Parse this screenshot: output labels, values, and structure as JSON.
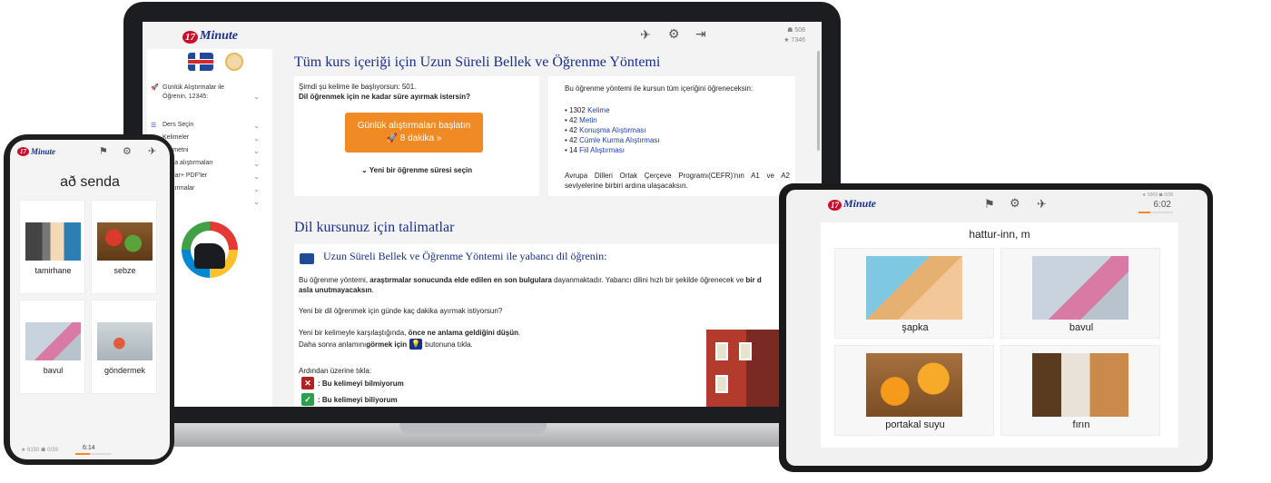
{
  "brand": {
    "logo_num": "17",
    "logo_text": "Minute",
    "logo_sub": "LANGUAGES"
  },
  "laptop": {
    "stats": {
      "line1": "☗ 508",
      "line2": "★ 7346"
    },
    "sidebar": {
      "items": [
        {
          "label": "Günlük Alıştırmalar ile Öğrenin, 12345:",
          "icon": "rocket-icon"
        },
        {
          "label": "Ders Seçin",
          "icon": "list-icon"
        },
        {
          "label": "Kelimeler",
          "icon": ""
        },
        {
          "label": "log metni",
          "icon": ""
        },
        {
          "label": "uşma alıştırmaları",
          "icon": ""
        },
        {
          "label": "rmalar+ PDF'ler",
          "icon": ""
        },
        {
          "label": "Alıştırmalar",
          "icon": ""
        },
        {
          "label": "alar",
          "icon": ""
        }
      ]
    },
    "main": {
      "title": "Tüm kurs içeriği için Uzun Süreli Bellek ve Öğrenme Yöntemi",
      "left_card": {
        "line1": "Şimdi şu kelime ile başlıyorsun: 501.",
        "line2": "Dil öğrenmek için ne kadar süre ayırmak istersin?",
        "button_line1": "Günlük alıştırmaları başlatın",
        "button_line2": "🚀 8 dakika »",
        "new_time": "⌄ Yeni bir öğrenme süresi seçin"
      },
      "right_card": {
        "intro": "Bu öğrenme yöntemi ile kursun tüm içeriğini öğreneceksin:",
        "items": [
          {
            "count": "• 1302",
            "label": "Kelime"
          },
          {
            "count": "• 42",
            "label": "Metin"
          },
          {
            "count": "• 42",
            "label": "Konuşma Alıştırması"
          },
          {
            "count": "• 42",
            "label": "Cümle Kurma Alıştırması"
          },
          {
            "count": "• 14",
            "label": "Fiil Alıştırması"
          }
        ],
        "outro": "Avrupa Dilleri Ortak Çerçeve Programı(CEFR)'nın A1 ve A2 seviyelerine birbiri ardına ulaşacaksın."
      },
      "instructions_title": "Dil kursunuz için talimatlar",
      "method_title": "Uzun Süreli Bellek ve Öğrenme Yöntemi ile yabancı dil öğrenin:",
      "p1_a": "Bu öğrenme yöntemi, ",
      "p1_b": "araştırmalar sonucunda elde edilen en son bulgulara",
      "p1_c": " dayanmaktadır. Yabancı dilini hızlı bir şekilde öğrenecek ve ",
      "p1_d": "bir d",
      "p1_e": "asla unutmayacaksın",
      "p1_f": ".",
      "p2": "Yeni bir dil öğrenmek için günde kaç dakika ayırmak istiyorsun?",
      "p3_a": "Yeni bir kelimeyle karşılaştığında, ",
      "p3_b": "önce ne anlama geldiğini düşün",
      "p3_c": ".",
      "p4_a": "Daha sonra anlamını ",
      "p4_b": "görmek için",
      "p4_c": " butonuna tıkla.",
      "p5": "Ardından üzerine tıkla:",
      "no_label": ": Bu kelimeyi bilmiyorum",
      "yes_label": ": Bu kelimeyi biliyorum"
    }
  },
  "phone": {
    "word": "að senda",
    "tiles": [
      {
        "label": "tamirhane",
        "img": "im-tire"
      },
      {
        "label": "sebze",
        "img": "im-veg"
      },
      {
        "label": "bavul",
        "img": "im-bavul"
      },
      {
        "label": "göndermek",
        "img": "im-gift"
      }
    ],
    "footer_stats": "★ 8150 ☗ 0/39",
    "timer": "6:14"
  },
  "tablet": {
    "stats": "★ 5069 ☗ 0/38",
    "timer": "6:02",
    "timer_progress": 0.35,
    "word": "hattur-inn, m",
    "tiles": [
      {
        "label": "şapka",
        "img": "im-hat"
      },
      {
        "label": "bavul",
        "img": "im-bavul"
      },
      {
        "label": "portakal suyu",
        "img": "im-orange"
      },
      {
        "label": "fırın",
        "img": "im-firin"
      }
    ]
  }
}
